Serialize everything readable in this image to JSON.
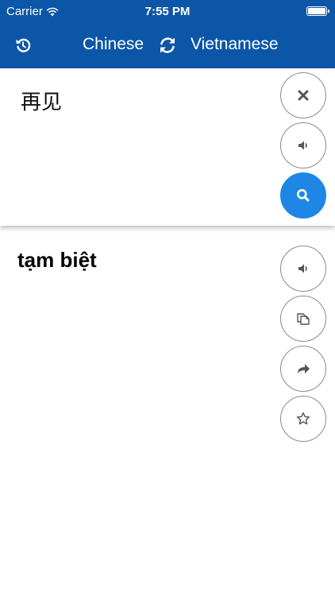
{
  "status_bar": {
    "carrier": "Carrier",
    "time": "7:55 PM",
    "battery_level": 1.0
  },
  "nav": {
    "source_language": "Chinese",
    "target_language": "Vietnamese",
    "icons": {
      "history": "history-icon",
      "swap": "swap-icon"
    }
  },
  "input": {
    "text": "再见",
    "buttons": {
      "clear": "close-icon",
      "speak": "speaker-icon",
      "translate": "search-icon"
    }
  },
  "output": {
    "text": "tạm biệt",
    "buttons": {
      "speak": "speaker-icon",
      "copy": "copy-icon",
      "share": "share-icon",
      "favorite": "star-icon"
    }
  },
  "colors": {
    "header": "#0c56a8",
    "accent": "#1e87e5",
    "button_border": "#8a8a8a",
    "icon": "#555555"
  }
}
